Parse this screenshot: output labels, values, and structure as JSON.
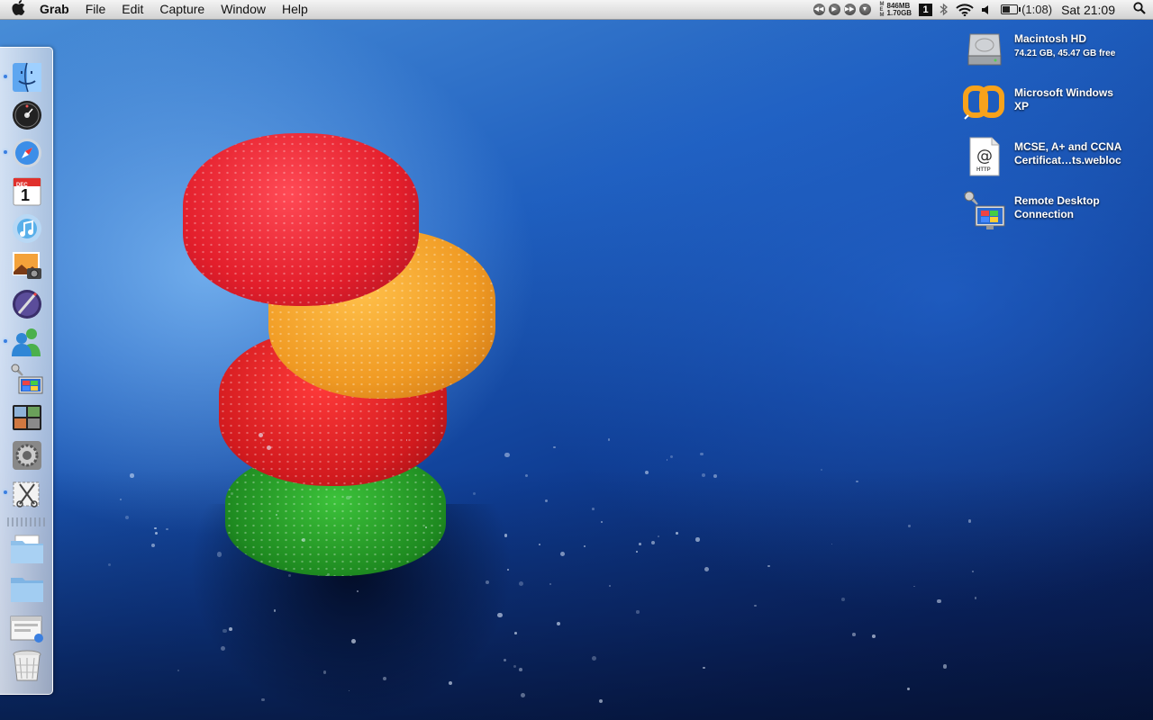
{
  "menubar": {
    "app_name": "Grab",
    "menus": [
      "File",
      "Edit",
      "Capture",
      "Window",
      "Help"
    ],
    "memory": {
      "letters": [
        "M",
        "E",
        "M"
      ],
      "used": "846MB",
      "free": "1.70GB"
    },
    "space_number": "1",
    "battery": {
      "time": "(1:08)",
      "level_percent": 55
    },
    "clock": "Sat 21:09",
    "icons": [
      "apple-icon",
      "rewind-icon",
      "play-icon",
      "forward-icon",
      "eject-icon",
      "bluetooth-icon",
      "wifi-icon",
      "volume-icon",
      "battery-icon",
      "spotlight-icon"
    ]
  },
  "dock": {
    "items": [
      {
        "name": "finder",
        "running": true
      },
      {
        "name": "dashboard",
        "running": false
      },
      {
        "name": "safari",
        "running": true
      },
      {
        "name": "ical",
        "running": false,
        "month": "DEC",
        "day": "1"
      },
      {
        "name": "itunes",
        "running": false
      },
      {
        "name": "iphoto",
        "running": false
      },
      {
        "name": "iweb",
        "running": false
      },
      {
        "name": "messenger",
        "running": true
      },
      {
        "name": "remote-desktop",
        "running": false
      },
      {
        "name": "spaces",
        "running": false
      },
      {
        "name": "system-preferences",
        "running": false
      },
      {
        "name": "grab",
        "running": true
      },
      {
        "name": "folder-documents",
        "running": false
      },
      {
        "name": "folder-downloads",
        "running": false
      },
      {
        "name": "window-stack",
        "running": false
      },
      {
        "name": "trash",
        "running": false
      }
    ]
  },
  "desktop": {
    "icons": [
      {
        "line1": "Macintosh HD",
        "line2": "74.21 GB, 45.47 GB free",
        "icon": "hard-drive-icon"
      },
      {
        "line1": "Microsoft Windows",
        "line2": "XP",
        "icon": "vmware-fusion-icon"
      },
      {
        "line1": "MCSE, A+ and CCNA",
        "line2": "Certificat…ts.webloc",
        "icon": "webloc-file-icon",
        "file_badge": "HTTP"
      },
      {
        "line1": "Remote Desktop",
        "line2": "Connection",
        "icon": "remote-desktop-icon"
      }
    ]
  },
  "colors": {
    "menubar_top": "#f4f4f4",
    "menubar_bottom": "#d2d2d2",
    "wallpaper_deep": "#0a2566",
    "wallpaper_light": "#4a8fd8"
  }
}
